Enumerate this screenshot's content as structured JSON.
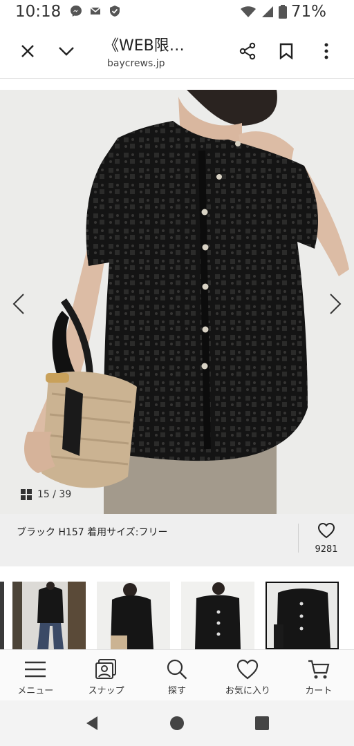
{
  "status_bar": {
    "time": "10:18",
    "battery": "71%",
    "icons": [
      "messenger-icon",
      "mail-icon",
      "shield-icon",
      "wifi-icon",
      "signal-icon",
      "battery-icon"
    ]
  },
  "browser": {
    "title": "《WEB限…",
    "url": "baycrews.jp"
  },
  "gallery": {
    "counter": "15 / 39"
  },
  "product": {
    "description": "ブラック H157 着用サイズ:フリー",
    "favorite_count": "9281"
  },
  "bottom_nav": {
    "items": [
      {
        "label": "メニュー",
        "icon": "menu-icon"
      },
      {
        "label": "スナップ",
        "icon": "snap-icon"
      },
      {
        "label": "探す",
        "icon": "search-icon"
      },
      {
        "label": "お気に入り",
        "icon": "heart-icon"
      },
      {
        "label": "カート",
        "icon": "cart-icon"
      }
    ]
  },
  "colors": {
    "accent": "#222222",
    "info_bg": "#efefef",
    "garment": "#151515"
  }
}
